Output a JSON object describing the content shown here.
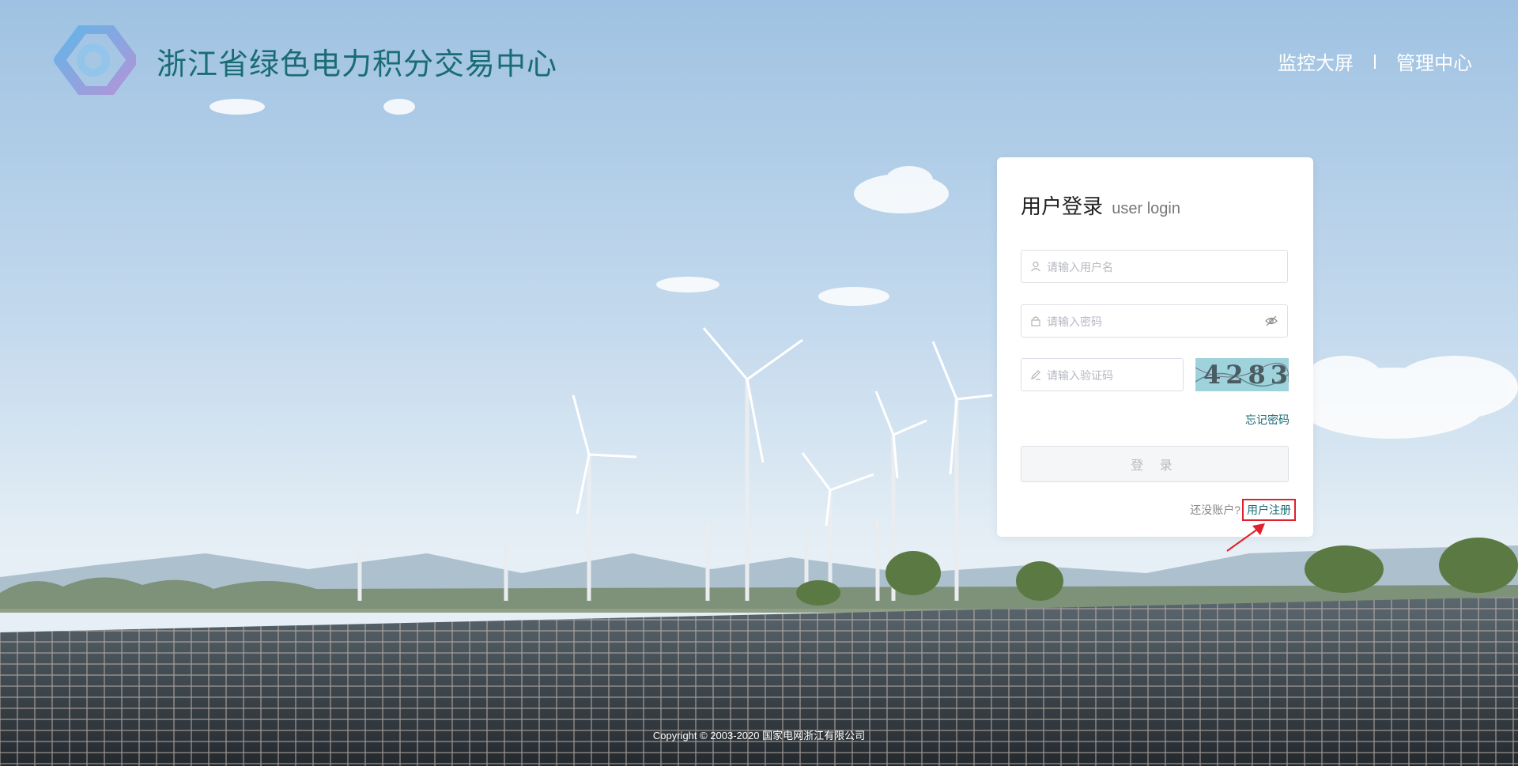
{
  "header": {
    "title": "浙江省绿色电力积分交易中心",
    "nav": [
      "监控大屏",
      "管理中心"
    ]
  },
  "login": {
    "title": "用户登录",
    "subtitle": "user login",
    "username_placeholder": "请输入用户名",
    "password_placeholder": "请输入密码",
    "captcha_placeholder": "请输入验证码",
    "captcha_text": "4283",
    "forgot": "忘记密码",
    "submit": "登 录",
    "no_account": "还没账户?",
    "register": "用户注册"
  },
  "footer": {
    "copyright": "Copyright © 2003-2020 国家电网浙江有限公司"
  },
  "colors": {
    "brand": "#1a6c74",
    "highlight": "#e0202a"
  }
}
